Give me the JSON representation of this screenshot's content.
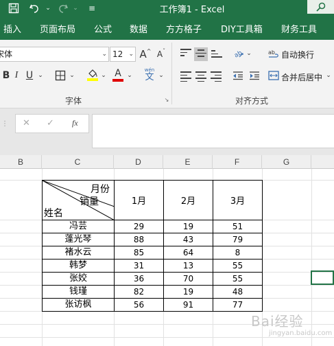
{
  "titlebar": {
    "title": "工作簿1  -  Excel",
    "save_icon": "save-icon",
    "undo_icon": "undo-icon",
    "redo_icon": "redo-icon",
    "search_icon": "search-icon"
  },
  "menu": [
    "插入",
    "页面布局",
    "公式",
    "数据",
    "方方格子",
    "DIY工具箱",
    "财务工具"
  ],
  "ribbon": {
    "font_name": "宋体",
    "font_size": "12",
    "grow_font": "A",
    "shrink_font": "A",
    "bold": "B",
    "italic": "I",
    "underline": "U",
    "font_color_glyph": "A",
    "phonetic": "文",
    "phonetic_top": "wén",
    "wrap_text": "自动换行",
    "merge_center": "合并后居中",
    "font_group_label": "字体",
    "align_group_label": "对齐方式"
  },
  "formula_bar": {
    "cancel": "✕",
    "confirm": "✓",
    "fx": "fx"
  },
  "columns": [
    "B",
    "C",
    "D",
    "E",
    "F",
    "G"
  ],
  "table": {
    "header_diag": {
      "top": "月份",
      "mid": "销量",
      "bottom": "姓名"
    },
    "months": [
      "1月",
      "2月",
      "3月"
    ],
    "rows": [
      {
        "name": "冯芸",
        "values": [
          "29",
          "19",
          "51"
        ]
      },
      {
        "name": "蓬光琴",
        "values": [
          "88",
          "43",
          "79"
        ]
      },
      {
        "name": "褚水云",
        "values": [
          "85",
          "64",
          "8"
        ]
      },
      {
        "name": "韩梦",
        "values": [
          "31",
          "13",
          "55"
        ]
      },
      {
        "name": "张姣",
        "values": [
          "36",
          "70",
          "55"
        ]
      },
      {
        "name": "钱瑾",
        "values": [
          "82",
          "19",
          "48"
        ]
      },
      {
        "name": "张访枫",
        "values": [
          "56",
          "91",
          "77"
        ]
      }
    ]
  },
  "colors": {
    "excel_green": "#217346",
    "highlight_yellow": "#ffff00",
    "font_red": "#e00000"
  },
  "watermark": {
    "main": "Bai经验",
    "sub": "jingyan.baidu.com"
  }
}
